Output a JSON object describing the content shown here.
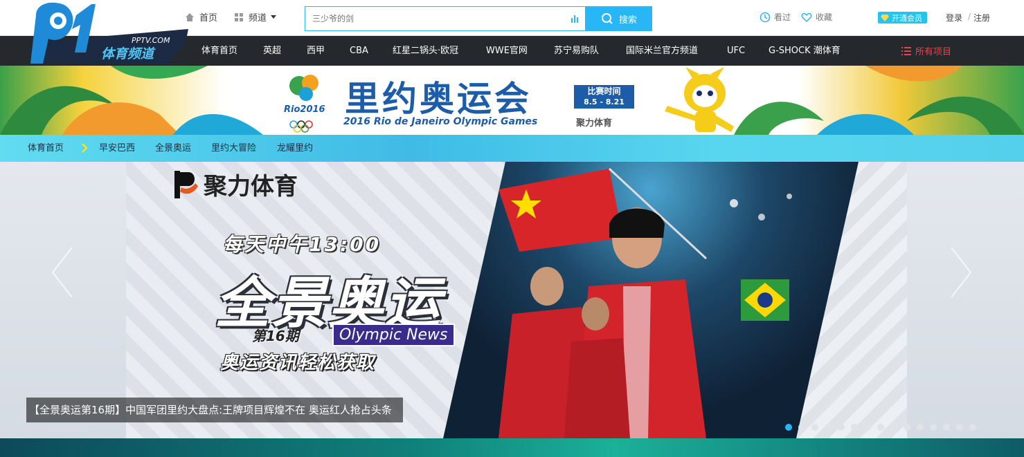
{
  "header": {
    "logo": {
      "domain": "PPTV.COM",
      "name": "体育频道"
    },
    "home": "首页",
    "channel": "频道",
    "search": {
      "placeholder": "三少爷的剑",
      "button": "搜索"
    },
    "history": "看过",
    "favorites": "收藏",
    "vip": "开通会员",
    "login": "登录",
    "separator": "/",
    "register": "注册"
  },
  "nav": {
    "items": [
      "体育首页",
      "英超",
      "西甲",
      "CBA",
      "红星二锅头·欧冠",
      "WWE官网",
      "苏宁易购队",
      "国际米兰官方频道",
      "UFC",
      "G-SHOCK 潮体育"
    ],
    "all": "所有项目"
  },
  "banner": {
    "title": "里约奥运会",
    "subtitle": "2016 Rio de Janeiro Olympic Games",
    "logo_text": "Rio2016",
    "date_label": "比赛时间",
    "date_range": "8.5 - 8.21",
    "brand": "聚力体育"
  },
  "breadcrumb": {
    "items": [
      "体育首页",
      "早安巴西",
      "全景奥运",
      "里约大冒险",
      "龙耀里约"
    ]
  },
  "hero": {
    "brand": "聚力体育",
    "time": "每天中午13:00",
    "program": "全景奥运",
    "issue": "第16期",
    "news": "Olympic News",
    "tagline": "奥运资讯轻松获取",
    "caption": "【全景奥运第16期】中国军团里约大盘点:王牌项目辉煌不在 奥运红人抢占头条",
    "slide_count": 15,
    "active_slide": 1
  },
  "colors": {
    "accent": "#29b6f6",
    "nav_bg": "#25282d",
    "nav_all": "#e64545",
    "banner_blue": "#1c5ca8"
  }
}
